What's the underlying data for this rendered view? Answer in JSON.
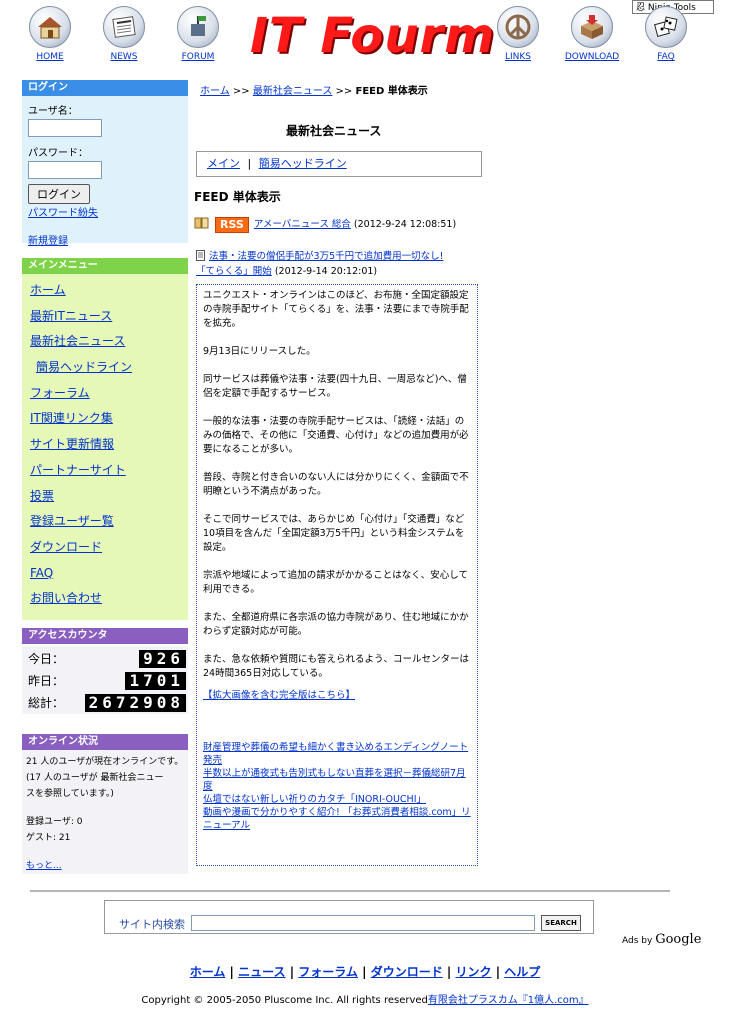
{
  "header": {
    "logo_text": "IT Fourm",
    "ninja_tools": "Ninja Tools",
    "nav": [
      {
        "label": "HOME",
        "icon": "house-icon"
      },
      {
        "label": "NEWS",
        "icon": "newspaper-icon"
      },
      {
        "label": "FORUM",
        "icon": "forum-icon"
      },
      {
        "label": "LINKS",
        "icon": "peace-icon"
      },
      {
        "label": "DOWNLOAD",
        "icon": "download-box-icon"
      },
      {
        "label": "FAQ",
        "icon": "dice-icon"
      }
    ]
  },
  "login": {
    "title": "ログイン",
    "username_label": "ユーザ名：",
    "password_label": "パスワード：",
    "button": "ログイン",
    "lost_password": "パスワード紛失",
    "register": "新規登録"
  },
  "main_menu": {
    "title": "メインメニュー",
    "items": [
      "ホーム",
      "最新ITニュース",
      "最新社会ニュース",
      "簡易ヘッドライン",
      "フォーラム",
      "IT関連リンク集",
      "サイト更新情報",
      "パートナーサイト",
      "投票",
      "登録ユーザー覧",
      "ダウンロード",
      "FAQ",
      "お問い合わせ"
    ]
  },
  "counter": {
    "title": "アクセスカウンタ",
    "today_label": "今日：",
    "today": "926",
    "yesterday_label": "昨日：",
    "yesterday": "1701",
    "total_label": "総計：",
    "total": "2672908"
  },
  "online": {
    "title": "オンライン状況",
    "line1": "21 人のユーザが現在オンラインです。",
    "line2": "(17 人のユーザが 最新社会ニュー",
    "line3": "スを参照しています。)",
    "members": "登録ユーザ: 0",
    "guests": "ゲスト: 21",
    "more": "もっと..."
  },
  "breadcrumb": {
    "home": "ホーム",
    "sep1": ">>",
    "section": "最新社会ニュース",
    "sep2": ">>",
    "current": "FEED 単体表示"
  },
  "center": {
    "page_title": "最新社会ニュース",
    "tab_main": "メイン",
    "tab_sep": "|",
    "tab_headline": "簡易ヘッドライン",
    "feed_heading": "FEED 単体表示",
    "rss_badge": "RSS",
    "feed_source": "アメーバニュース 総合",
    "feed_date": "(2012-9-24 12:08:51)",
    "article_title_1": "法事・法要の僧侶手配が3万5千円で追加費用一切なし!",
    "article_title_2": "「てらくる」開始",
    "article_date": "(2012-9-14 20:12:01)"
  },
  "article": {
    "paragraphs": [
      "ユニクエスト・オンラインはこのほど、お布施・全国定額設定の寺院手配サイト「てらくる」を、法事・法要にまで寺院手配を拡充。",
      "9月13日にリリースした。",
      "同サービスは葬儀や法事・法要(四十九日、一周忌など)へ、僧侶を定額で手配するサービス。",
      "一般的な法事・法要の寺院手配サービスは、「読経・法話」のみの価格で、その他に「交通費、心付け」などの追加費用が必要になることが多い。",
      "普段、寺院と付き合いのない人には分かりにくく、金額面で不明瞭という不満点があった。",
      "そこで同サービスでは、あらかじめ「心付け」「交通費」など10項目を含んだ「全国定額3万5千円」という料金システムを設定。",
      "宗派や地域によって追加の請求がかかることはなく、安心して利用できる。",
      "また、全都道府県に各宗派の協力寺院があり、住む地域にかかわらず定額対応が可能。",
      "また、急な依頼や質問にも答えられるよう、コールセンターは24時間365日対応している。"
    ],
    "full_version_link": "【拡大画像を含む完全版はこちら】",
    "related": [
      "財産管理や葬儀の希望も細かく書き込めるエンディングノート発売",
      "半数以上が通夜式も告別式もしない直葬を選択－葬儀総研7月度",
      "仏壇ではない新しい祈りのカタチ「INORI-OUCHI」",
      "動画や漫画で分かりやすく紹介! 「お葬式消費者相談.com」リニューアル"
    ]
  },
  "search": {
    "label": "サイト内検索",
    "value": "",
    "button": "SEARCH",
    "ads_by": "Ads by",
    "google": "Google"
  },
  "footer": {
    "links": [
      "ホーム",
      "ニュース",
      "フォーラム",
      "ダウンロード",
      "リンク",
      "ヘルプ"
    ],
    "sep": "|",
    "copyright": "Copyright © 2005-2050 Pluscome Inc. All rights reserved",
    "company": "有限会社プラスカム",
    "site": "『1億人.com』"
  },
  "colors": {
    "login_head": "#3a8ee6",
    "login_body": "#dff1fb",
    "menu_head": "#7fd34a",
    "menu_body": "#e6f8b8",
    "counter_head": "#8a5fbf",
    "logo_red": "#ff1a1a",
    "rss_orange": "#ff6a14",
    "link_blue": "#0033cc"
  }
}
